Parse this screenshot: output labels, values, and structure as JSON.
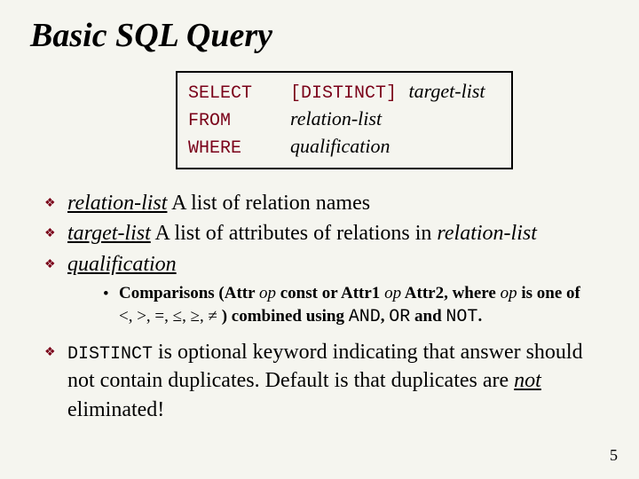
{
  "title": "Basic SQL Query",
  "query": {
    "select_kw": "SELECT",
    "distinct_kw": "[DISTINCT]",
    "select_arg": "target-list",
    "from_kw": "FROM",
    "from_arg": "relation-list",
    "where_kw": "WHERE",
    "where_arg": "qualification"
  },
  "b1": {
    "term": "relation-list",
    "rest": "  A list of relation names"
  },
  "b2": {
    "term": "target-list",
    "rest": "  A list of attributes of relations in ",
    "tail_it": "relation-list"
  },
  "b3": {
    "term": "qualification"
  },
  "sub": {
    "lead": "Comparisons (Attr ",
    "op1": "op",
    "mid1": " const or Attr1 ",
    "op2": "op",
    "mid2": " Attr2, where ",
    "op3": "op",
    "mid3": " is one of",
    "ops_line_prefix": "",
    "ops": "<, >, =, ≤, ≥, ≠",
    "combined": " )  combined using ",
    "and": "AND",
    "sep1": ", ",
    "or": "OR",
    "sep2": " and ",
    "not": "NOT",
    "period": "."
  },
  "b4": {
    "kw": "DISTINCT",
    "rest1": " is optional keyword indicating that answer should not contain duplicates.  Default is that duplicates are ",
    "not_word": "not",
    "rest2": " eliminated!"
  },
  "page": "5"
}
